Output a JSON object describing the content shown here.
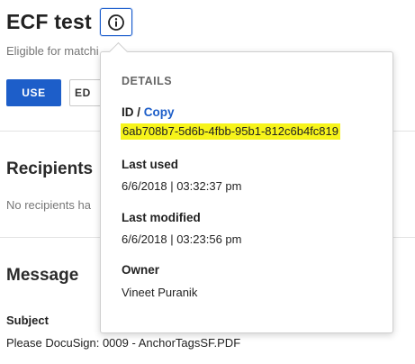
{
  "template": {
    "title": "ECF test",
    "subtitle": "Eligible for matchi",
    "use_label": "USE",
    "edit_label": "ED",
    "recipients_heading": "Recipients",
    "recipients_empty": "No recipients ha",
    "message_heading": "Message",
    "subject_label": "Subject",
    "subject_value": "Please DocuSign: 0009 - AnchorTagsSF.PDF"
  },
  "details": {
    "heading": "DETAILS",
    "id_label": "ID",
    "id_separator": "/",
    "copy_label": "Copy",
    "id_value": "6ab708b7-5d6b-4fbb-95b1-812c6b4fc819",
    "last_used_label": "Last used",
    "last_used_value": "6/6/2018 | 03:32:37 pm",
    "last_modified_label": "Last modified",
    "last_modified_value": "6/6/2018 | 03:23:56 pm",
    "owner_label": "Owner",
    "owner_value": "Vineet Puranik"
  },
  "icons": {
    "info": "info-icon"
  },
  "colors": {
    "accent_blue": "#1d5ec9",
    "highlight_yellow": "#f7f41a",
    "muted_text": "#777777"
  }
}
